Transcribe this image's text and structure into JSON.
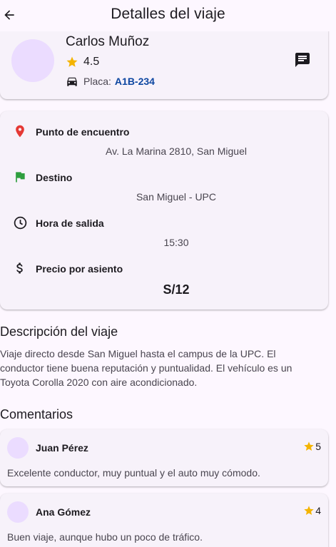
{
  "app_bar": {
    "title": "Detalles del viaje"
  },
  "driver": {
    "name": "Carlos Muñoz",
    "rating": "4.5",
    "plate_label": "Placa:",
    "plate": "A1B-234"
  },
  "trip": {
    "meeting_point_label": "Punto de encuentro",
    "meeting_point": "Av. La Marina 2810, San Miguel",
    "destination_label": "Destino",
    "destination": "San Miguel - UPC",
    "departure_label": "Hora de salida",
    "departure_time": "15:30",
    "price_label": "Precio por asiento",
    "price": "S/12"
  },
  "description": {
    "title": "Descripción del viaje",
    "text": "Viaje directo desde San Miguel hasta el campus de la UPC. El conductor tiene buena reputación y puntualidad. El vehículo es un Toyota Corolla 2020 con aire acondicionado."
  },
  "comments": {
    "title": "Comentarios",
    "items": [
      {
        "author": "Juan Pérez",
        "rating": "5",
        "text": "Excelente conductor, muy puntual y el auto muy cómodo."
      },
      {
        "author": "Ana Gómez",
        "rating": "4",
        "text": "Buen viaje, aunque hubo un poco de tráfico."
      }
    ]
  },
  "colors": {
    "background": "#fdf7ff",
    "card": "#f7f2fa",
    "avatar": "#ebdcff",
    "star": "#f4b400",
    "pin": "#e53935",
    "flag": "#2e9e3e",
    "plate": "#0d47a1"
  },
  "icons": [
    "arrow-back-icon",
    "star-icon",
    "car-icon",
    "message-icon",
    "location-pin-icon",
    "flag-icon",
    "clock-icon",
    "dollar-icon"
  ]
}
